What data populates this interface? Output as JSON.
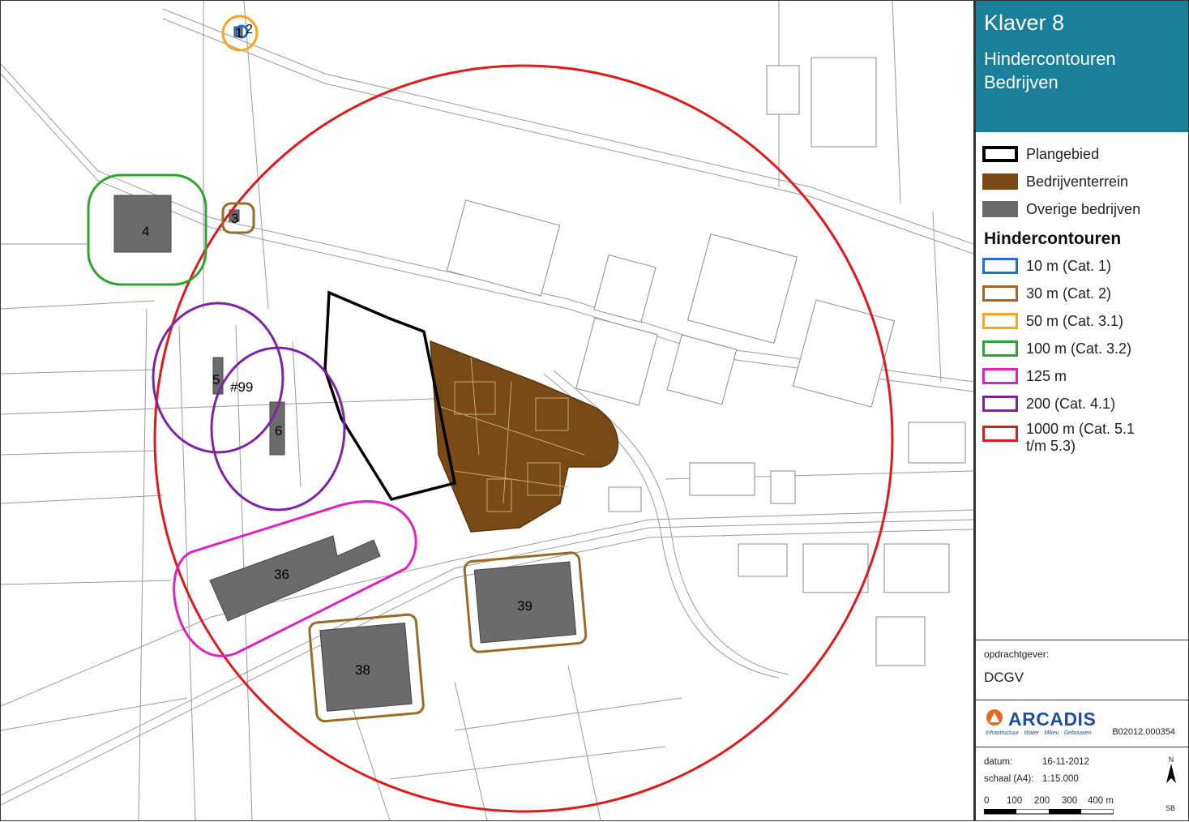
{
  "title": {
    "main": "Klaver 8",
    "line1": "Hindercontouren",
    "line2": "Bedrijven"
  },
  "legend": {
    "areas": [
      {
        "label": "Plangebied",
        "color": "#000000",
        "style": "outline"
      },
      {
        "label": "Bedrijventerrein",
        "color": "#7a4a16",
        "style": "fill"
      },
      {
        "label": "Overige bedrijven",
        "color": "#6b6b6b",
        "style": "fill"
      }
    ],
    "contours_heading": "Hindercontouren",
    "contours": [
      {
        "label": "10 m (Cat. 1)",
        "color": "#1e6fe0"
      },
      {
        "label": "30 m (Cat. 2)",
        "color": "#9a6b26"
      },
      {
        "label": "50 m (Cat. 3.1)",
        "color": "#f5a623"
      },
      {
        "label": "100 m (Cat. 3.2)",
        "color": "#2fa52f"
      },
      {
        "label": "125 m",
        "color": "#e020c0"
      },
      {
        "label": "200 (Cat. 4.1)",
        "color": "#7e22a8"
      },
      {
        "label": "1000 m (Cat. 5.1",
        "label2": "t/m 5.3)",
        "color": "#e0191b"
      }
    ]
  },
  "client": {
    "key": "opdrachtgever:",
    "value": "DCGV"
  },
  "company": {
    "name": "ARCADIS",
    "tagline": "Infrastructuur · Water · Milieu · Gebouwen",
    "project_number": "B02012.000354"
  },
  "meta": {
    "date_key": "datum:",
    "date_value": "16-11-2012",
    "scale_key": "schaal (A4):",
    "scale_value": "1:15.000",
    "scalebar_labels": [
      "0",
      "100",
      "200",
      "300",
      "400 m"
    ],
    "north": "N",
    "initials": "SB"
  },
  "map_labels": {
    "l1": "1",
    "l2": "2",
    "l3": "3",
    "l4": "4",
    "l5": "5",
    "l6": "6",
    "l99": "#99",
    "l36": "36",
    "l38": "38",
    "l39": "39"
  }
}
